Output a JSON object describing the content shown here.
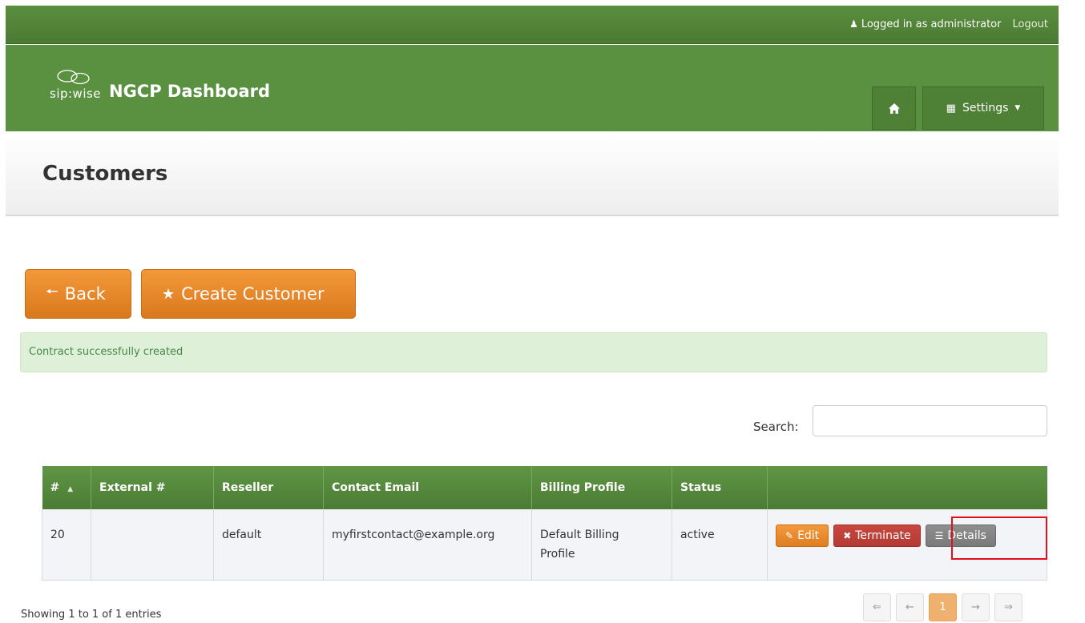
{
  "topbar": {
    "user_text": "Logged in as administrator",
    "logout": "Logout"
  },
  "header": {
    "logo_text": "sip:wise",
    "app_title": "NGCP Dashboard",
    "settings_label": "Settings"
  },
  "page": {
    "title": "Customers"
  },
  "actions": {
    "back": "Back",
    "create": "Create Customer"
  },
  "alert": {
    "text": "Contract successfully created"
  },
  "search": {
    "label": "Search:",
    "value": ""
  },
  "table": {
    "columns": [
      "#",
      "External #",
      "Reseller",
      "Contact Email",
      "Billing Profile",
      "Status",
      ""
    ],
    "rows": [
      {
        "id": "20",
        "external": "",
        "reseller": "default",
        "email": "myfirstcontact@example.org",
        "billing_line1": "Default Billing",
        "billing_line2": "Profile",
        "status": "active",
        "edit": "Edit",
        "terminate": "Terminate",
        "details": "Details"
      }
    ]
  },
  "footer": {
    "info": "Showing 1 to 1 of 1 entries",
    "pager": {
      "first": "⇐",
      "prev": "←",
      "page": "1",
      "next": "→",
      "last": "⇒"
    }
  },
  "colors": {
    "brand_green": "#5a9140",
    "accent_orange": "#e8882a",
    "danger_red": "#bd3f38",
    "alert_bg": "#dff0d8",
    "highlight": "#e0101e"
  }
}
